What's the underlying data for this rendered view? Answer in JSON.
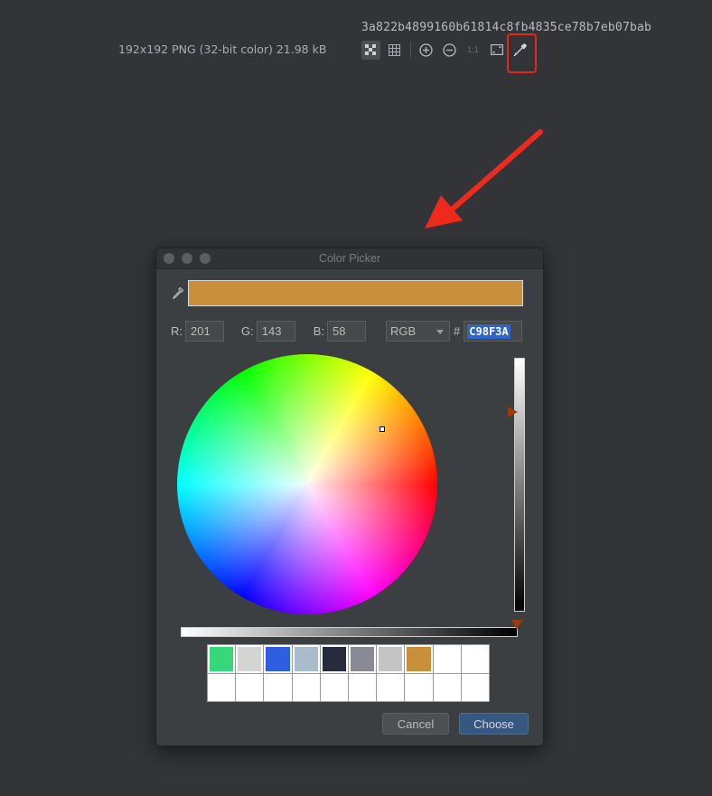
{
  "viewer": {
    "hash": "3a822b4899160b61814c8fb4835ce78b7eb07bab",
    "info": "192x192 PNG (32-bit color) 21.98 kB",
    "toolbar": {
      "icons": [
        "chessboard-icon",
        "grid-icon",
        "zoom-in-icon",
        "zoom-out-icon",
        "actual-size-icon",
        "fit-icon",
        "color-picker-icon"
      ],
      "actual_size_label": "1:1"
    }
  },
  "annotation": {
    "highlight_color": "#e8261b"
  },
  "dialog": {
    "title": "Color Picker",
    "preview_color": "#C98F3A",
    "r_label": "R:",
    "r_value": "201",
    "g_label": "G:",
    "g_value": "143",
    "b_label": "B:",
    "b_value": "58",
    "mode": "RGB",
    "hash_label": "#",
    "hex": "C98F3A",
    "recent_colors": [
      "#35d97a",
      "#d4d6d3",
      "#2f5fe0",
      "#aabbcc",
      "#262b3d",
      "#8a8a96",
      "#c4c4c4",
      "#c98f3a",
      "",
      "",
      "",
      "",
      "",
      "",
      "",
      "",
      "",
      "",
      "",
      ""
    ],
    "cancel_label": "Cancel",
    "choose_label": "Choose"
  }
}
